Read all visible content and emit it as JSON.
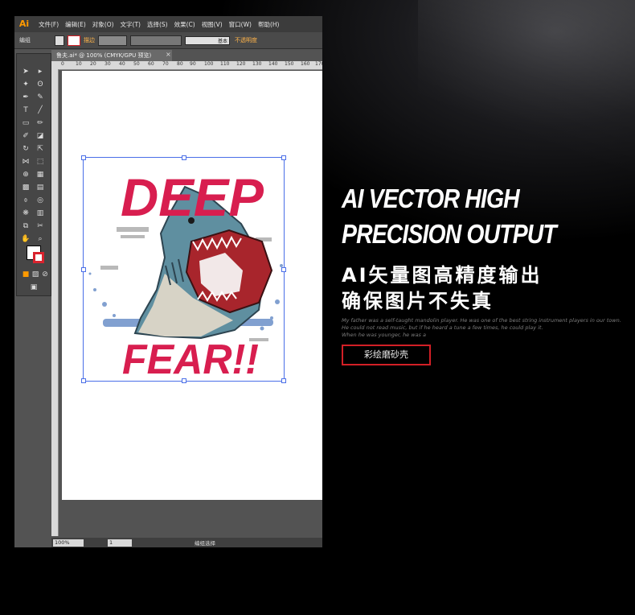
{
  "app": {
    "logo": "Ai",
    "menu": [
      "文件(F)",
      "编辑(E)",
      "对象(O)",
      "文字(T)",
      "选择(S)",
      "效果(C)",
      "视图(V)",
      "窗口(W)",
      "帮助(H)"
    ],
    "control_bar": {
      "label": "编组",
      "stroke_label": "描边",
      "stroke_style": "基本",
      "opacity_label": "不透明度"
    },
    "document_tab": "鲁夫.ai* @ 100% (CMYK/GPU 预览)",
    "tab_close": "×",
    "ruler_ticks": [
      "0",
      "10",
      "20",
      "30",
      "40",
      "50",
      "60",
      "70",
      "80",
      "90",
      "100",
      "110",
      "120",
      "130",
      "140",
      "150",
      "160",
      "170"
    ],
    "status_bar": {
      "zoom": "100%",
      "page": "1",
      "label": "编组选择"
    }
  },
  "artwork": {
    "top_text": "DEEP",
    "bottom_text": "FEAR!!",
    "colors": {
      "text": "#d81e4f",
      "shark_body": "#5f8fa0",
      "mouth": "#a8252c",
      "selection": "#4a6ee8"
    }
  },
  "copy": {
    "headline_1": "AI VECTOR HIGH",
    "headline_2": "PRECISION OUTPUT",
    "cn_line_1": "AI矢量图高精度输出",
    "cn_line_2": "确保图片不失真",
    "small_1": "My father was a self-taught mandolin player. He was one of the best string instrument players in our town.",
    "small_2": "He could not read music, but if he heard a tune a few times, he could play it.",
    "small_3": "When he was younger, he was a",
    "cta": "彩绘磨砂壳",
    "accent": "#d21f26"
  }
}
